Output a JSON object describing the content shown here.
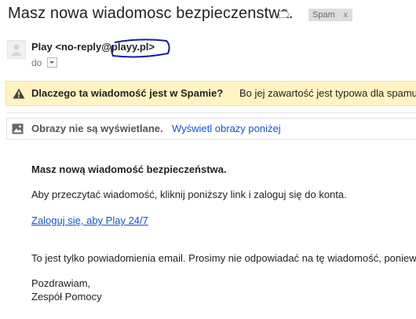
{
  "subject": "Masz nowa wiadomosc bezpieczenstwa.",
  "spam_chip": {
    "label": "Spam",
    "close": "x"
  },
  "sender": {
    "name": "Play",
    "email": "<no-reply@playy.pl>",
    "to_label": "do"
  },
  "spam_warning": {
    "question": "Dlaczego ta wiadomość jest w Spamie?",
    "answer": "Bo jej zawartość jest typowa dla spamu."
  },
  "images_notice": {
    "message": "Obrazy nie są wyświetlane.",
    "link": "Wyświetl obrazy poniżej"
  },
  "message_body": {
    "heading": "Masz nową wiadomość bezpieczeństwa.",
    "instruction": "Aby przeczytać wiadomość, kliknij poniższy link i zaloguj się do konta.",
    "link": "Zaloguj się, aby Play 24/7",
    "disclaimer": "To jest tylko powiadomienia email. Prosimy nie odpowiadać na tę wiadomość, poniew",
    "greeting": "Pozdrawiam,",
    "signature": "Zespół Pomocy"
  },
  "colors": {
    "link": "#1155cc",
    "warning_bg": "#fff4c2",
    "annotation_circle": "#1a1aa6"
  },
  "icons": [
    "label-tag-icon",
    "avatar-icon",
    "dropdown-arrow-icon",
    "warning-icon",
    "image-icon"
  ]
}
